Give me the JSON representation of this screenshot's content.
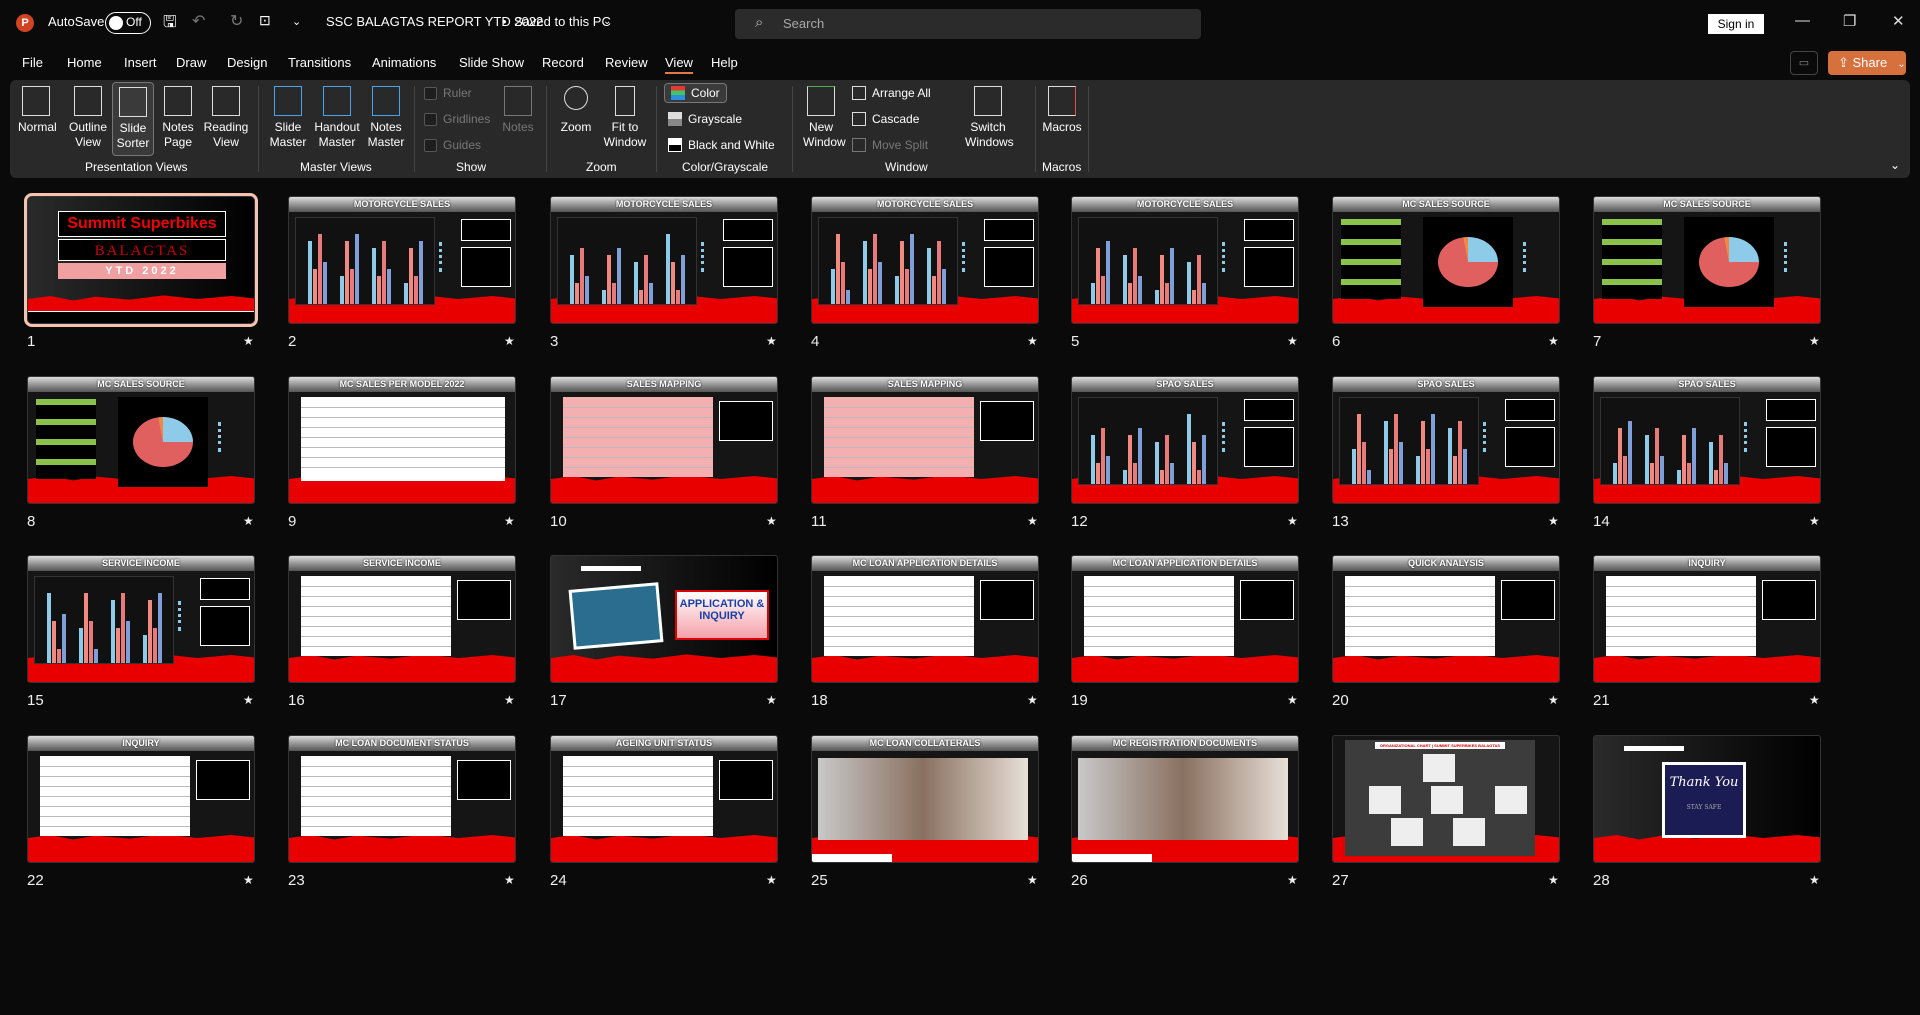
{
  "titlebar": {
    "autosave_label": "AutoSave",
    "autosave_state": "Off",
    "document_title": "SSC BALAGTAS REPORT YTD 2022",
    "save_status": "Saved to this PC",
    "search_placeholder": "Search",
    "sign_in": "Sign in"
  },
  "tabs": [
    "File",
    "Home",
    "Insert",
    "Draw",
    "Design",
    "Transitions",
    "Animations",
    "Slide Show",
    "Record",
    "Review",
    "View",
    "Help"
  ],
  "active_tab": "View",
  "share_label": "Share",
  "ribbon": {
    "presentation_views": {
      "label": "Presentation Views",
      "buttons": [
        "Normal",
        "Outline View",
        "Slide Sorter",
        "Notes Page",
        "Reading View"
      ]
    },
    "master_views": {
      "label": "Master Views",
      "buttons": [
        "Slide Master",
        "Handout Master",
        "Notes Master"
      ]
    },
    "show": {
      "label": "Show",
      "checkboxes": [
        "Ruler",
        "Gridlines",
        "Guides"
      ],
      "notes": "Notes"
    },
    "zoom": {
      "label": "Zoom",
      "buttons": [
        "Zoom",
        "Fit to Window"
      ]
    },
    "color": {
      "label": "Color/Grayscale",
      "options": [
        "Color",
        "Grayscale",
        "Black and White"
      ],
      "selected": "Color"
    },
    "window": {
      "label": "Window",
      "new_window": "New Window",
      "arrange_all": "Arrange All",
      "cascade": "Cascade",
      "move_split": "Move Split",
      "switch_windows": "Switch Windows"
    },
    "macros": {
      "label": "Macros",
      "button": "Macros"
    }
  },
  "colors": {
    "accent": "#d6703c",
    "slide_red": "#e80000",
    "tab_underline": "#e07b47"
  },
  "cover": {
    "brand": "Summit Superbikes",
    "branch": "BALAGTAS",
    "period": "YTD 2022"
  },
  "slides": [
    {
      "n": "1",
      "title": ""
    },
    {
      "n": "2",
      "title": "MOTORCYCLE SALES"
    },
    {
      "n": "3",
      "title": "MOTORCYCLE SALES"
    },
    {
      "n": "4",
      "title": "MOTORCYCLE SALES"
    },
    {
      "n": "5",
      "title": "MOTORCYCLE SALES"
    },
    {
      "n": "6",
      "title": "MC SALES SOURCE"
    },
    {
      "n": "7",
      "title": "MC SALES SOURCE"
    },
    {
      "n": "8",
      "title": "MC SALES SOURCE"
    },
    {
      "n": "9",
      "title": "MC SALES PER MODEL 2022"
    },
    {
      "n": "10",
      "title": "SALES MAPPING"
    },
    {
      "n": "11",
      "title": "SALES MAPPING"
    },
    {
      "n": "12",
      "title": "SPAO SALES"
    },
    {
      "n": "13",
      "title": "SPAO SALES"
    },
    {
      "n": "14",
      "title": "SPAO SALES"
    },
    {
      "n": "15",
      "title": "SERVICE INCOME"
    },
    {
      "n": "16",
      "title": "SERVICE INCOME"
    },
    {
      "n": "17",
      "title": "APPLICATION & INQUIRY"
    },
    {
      "n": "18",
      "title": "MC LOAN APPLICATION DETAILS"
    },
    {
      "n": "19",
      "title": "MC LOAN APPLICATION DETAILS"
    },
    {
      "n": "20",
      "title": "QUICK ANALYSIS"
    },
    {
      "n": "21",
      "title": "INQUIRY"
    },
    {
      "n": "22",
      "title": "INQUIRY"
    },
    {
      "n": "23",
      "title": "MC LOAN DOCUMENT STATUS"
    },
    {
      "n": "24",
      "title": "AGEING UNIT STATUS"
    },
    {
      "n": "25",
      "title": "MC LOAN COLLATERALS"
    },
    {
      "n": "26",
      "title": "MC REGISTRATION DOCUMENTS"
    },
    {
      "n": "27",
      "title": "ORGANIZATIONAL CHART | SUMMIT SUPERBIKES BALAGTAS"
    },
    {
      "n": "28",
      "title": "Thank You",
      "subtitle": "STAY SAFE"
    }
  ]
}
